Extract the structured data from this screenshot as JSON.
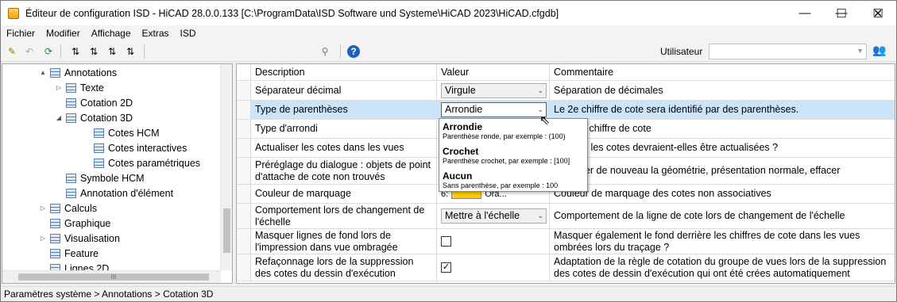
{
  "window": {
    "title": "Éditeur de configuration ISD  - HiCAD 28.0.0.133 [C:\\ProgramData\\ISD Software und Systeme\\HiCAD 2023\\HiCAD.cfgdb]"
  },
  "menu": [
    "Fichier",
    "Modifier",
    "Affichage",
    "Extras",
    "ISD"
  ],
  "toolbar": {
    "user_label": "Utilisateur",
    "user_value": ""
  },
  "tree": {
    "items": [
      {
        "label": "Annotations",
        "level": 0,
        "arrow": "▲"
      },
      {
        "label": "Texte",
        "level": 1,
        "arrow": "▷"
      },
      {
        "label": "Cotation 2D",
        "level": 1,
        "arrow": ""
      },
      {
        "label": "Cotation 3D",
        "level": 1,
        "arrow": "◢"
      },
      {
        "label": "Cotes HCM",
        "level": 2,
        "arrow": ""
      },
      {
        "label": "Cotes interactives",
        "level": 2,
        "arrow": ""
      },
      {
        "label": "Cotes paramétriques",
        "level": 2,
        "arrow": ""
      },
      {
        "label": "Symbole HCM",
        "level": 1,
        "arrow": ""
      },
      {
        "label": "Annotation d'élément",
        "level": 1,
        "arrow": ""
      },
      {
        "label": "Calculs",
        "level": 0,
        "arrow": "▷"
      },
      {
        "label": "Graphique",
        "level": 0,
        "arrow": ""
      },
      {
        "label": "Visualisation",
        "level": 0,
        "arrow": "▷"
      },
      {
        "label": "Feature",
        "level": 0,
        "arrow": ""
      },
      {
        "label": "Lignes 2D",
        "level": 0,
        "arrow": ""
      }
    ],
    "hscroll_label": "III"
  },
  "grid": {
    "columns": [
      "Description",
      "Valeur",
      "Commentaire"
    ],
    "rows": [
      {
        "desc": "Séparateur décimal",
        "type": "combo",
        "value": "Virgule",
        "comment": "Séparation de décimales",
        "h": 24
      },
      {
        "desc": "Type de parenthèses",
        "type": "combo-open",
        "value": "Arrondie",
        "comment": "Le 2e chiffre de cote sera identifié par des parenthèses.",
        "h": 24
      },
      {
        "desc": "Type d'arrondi",
        "type": "none",
        "value": "",
        "comment": "ondi du chiffre de cote",
        "h": 24
      },
      {
        "desc": "Actualiser les cotes dans les vues",
        "type": "none",
        "value": "",
        "comment": "elle vue les cotes devraient-elles être actualisées ?",
        "h": 24
      },
      {
        "desc": "Préréglage du dialogue : objets de point d'attache de cote non trouvés",
        "type": "none",
        "value": "",
        "comment": ", calculer de nouveau la géométrie, présentation normale, effacer",
        "h": 34
      },
      {
        "desc": "Couleur de marquage",
        "type": "color",
        "value": "Ora...",
        "prefix": "6:",
        "comment": "Couleur de marquage des cotes non associatives",
        "h": 24
      },
      {
        "desc": "Comportement lors de changement de l'échelle",
        "type": "combo",
        "value": "Mettre à l'échelle",
        "comment": "Comportement de la ligne de cote lors de changement de l'échelle",
        "h": 32
      },
      {
        "desc": "Masquer lignes de fond lors de l'impression dans vue ombragée",
        "type": "check",
        "value": "",
        "comment": "Masquer également le fond derrière les chiffres de cote dans les vues ombrées lors du traçage ?",
        "h": 32
      },
      {
        "desc": "Refaçonnage lors de la suppression des cotes du dessin d'exécution",
        "type": "check",
        "value": "✓",
        "comment": "Adaptation de la règle de cotation du groupe de vues lors de la suppression des cotes de dessin d'exécution qui ont été crées automatiquement",
        "h": 34
      }
    ]
  },
  "dropdown": {
    "options": [
      {
        "title": "Arrondie",
        "sub": "Parenthèse ronde, par exemple : (100)"
      },
      {
        "title": "Crochet",
        "sub": "Parenthèse crochet, par exemple : [100]"
      },
      {
        "title": "Aucun",
        "sub": "Sans parenthèse, par exemple : 100"
      }
    ]
  },
  "status": "Paramètres système > Annotations > Cotation 3D",
  "colors": {
    "accent": "#cce4f7",
    "swatch": "#ffcc00"
  }
}
